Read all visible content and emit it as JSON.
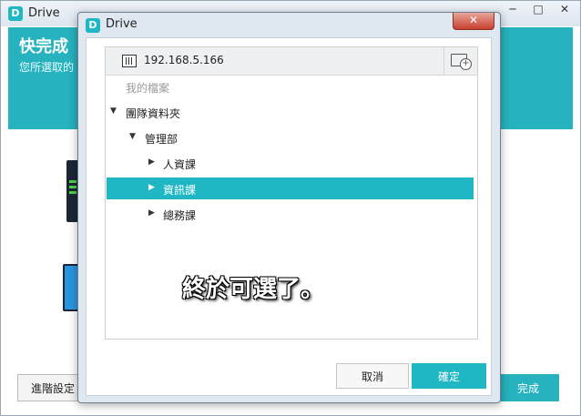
{
  "background_window": {
    "app_logo": "D",
    "title": "Drive",
    "controls": {
      "minimize": "─",
      "maximize": "□",
      "close": "✕"
    },
    "heading": "快完成",
    "subtext": "您所選取的",
    "advanced_button": "進階設定",
    "finish_button": "完成"
  },
  "dialog": {
    "app_logo": "D",
    "title": "Drive",
    "close": "✕",
    "server": {
      "address": "192.168.5.166",
      "icon": "server-icon",
      "new_folder_icon": "folder-plus-icon"
    },
    "tree": [
      {
        "label": "我的檔案",
        "level": 0,
        "expander": ""
      },
      {
        "label": "團隊資料夾",
        "level": 0,
        "expander": "▼"
      },
      {
        "label": "管理部",
        "level": 1,
        "expander": "▼"
      },
      {
        "label": "人資課",
        "level": 2,
        "expander": "▶"
      },
      {
        "label": "資訊課",
        "level": 2,
        "expander": "▶",
        "selected": true
      },
      {
        "label": "總務課",
        "level": 2,
        "expander": "▶"
      }
    ],
    "cancel_button": "取消",
    "ok_button": "確定"
  },
  "caption": "終於可選了。",
  "colors": {
    "accent": "#1fb7c4",
    "banner": "#26b2be"
  }
}
